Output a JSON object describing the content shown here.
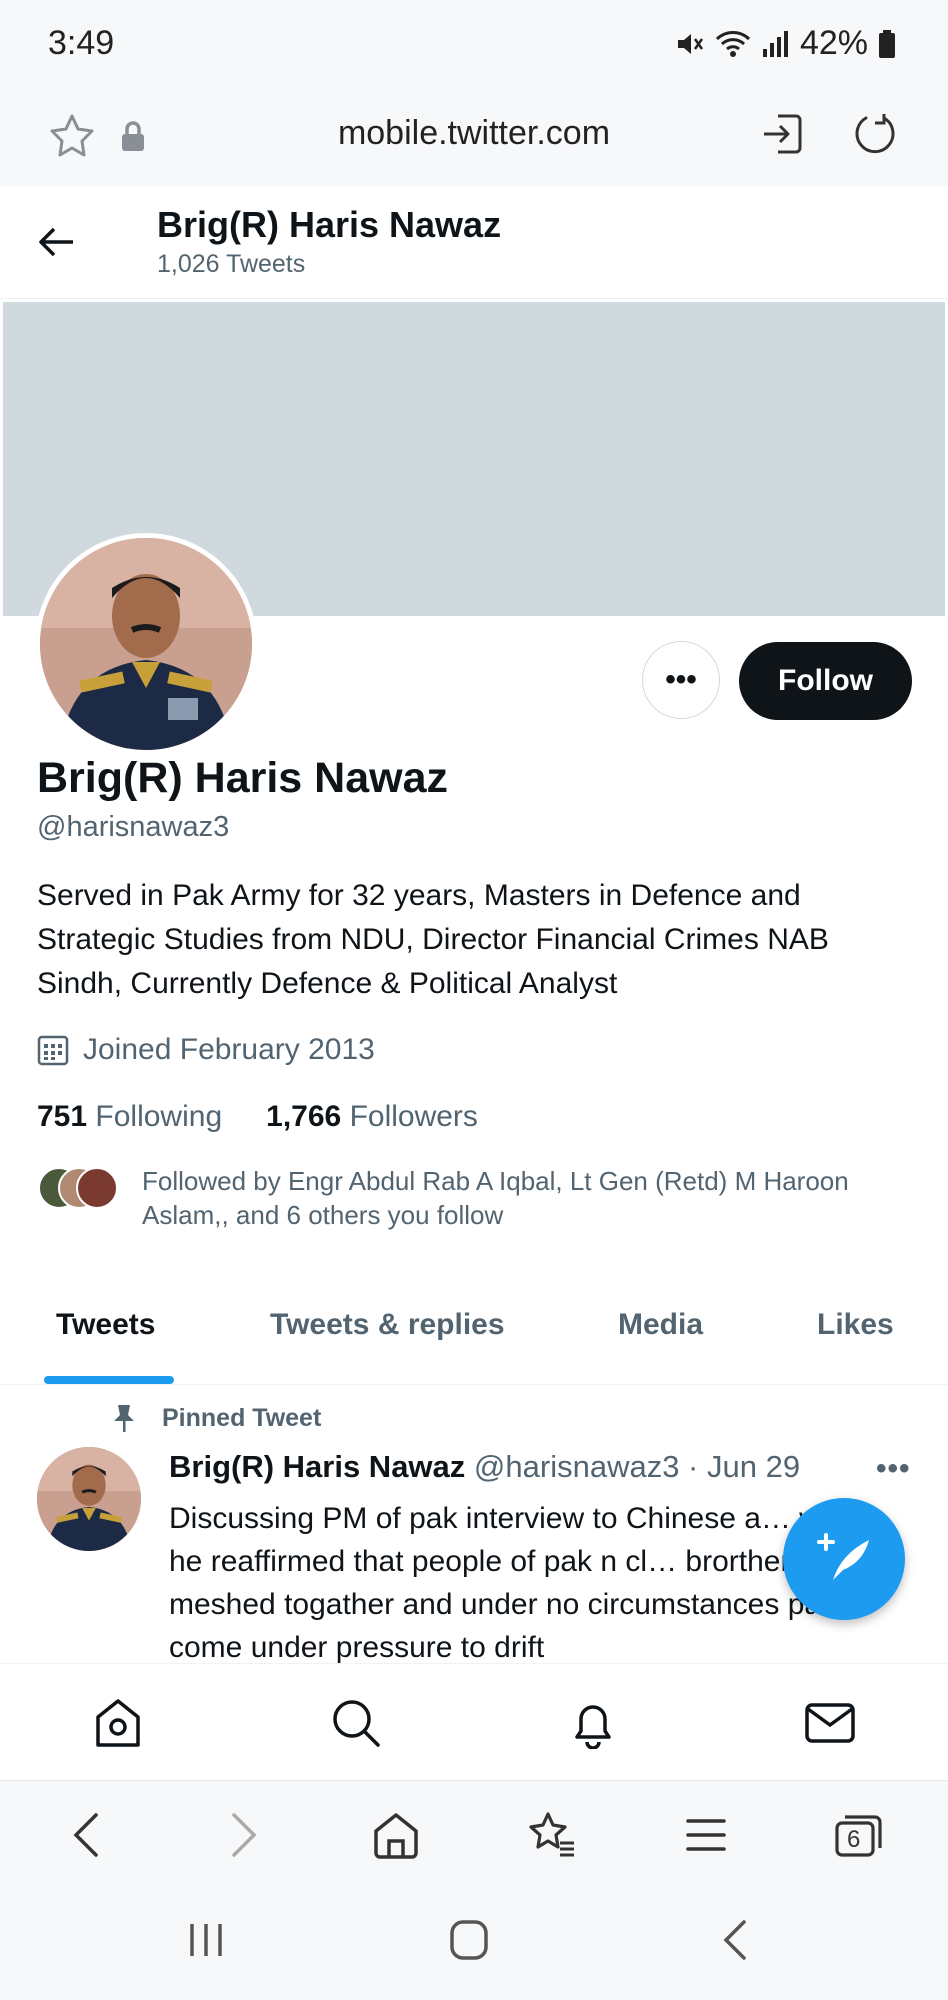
{
  "status_bar": {
    "time": "3:49",
    "battery": "42%"
  },
  "browser": {
    "url": "mobile.twitter.com",
    "tab_count": "6"
  },
  "header": {
    "name": "Brig(R) Haris Nawaz",
    "tweet_count": "1,026 Tweets"
  },
  "profile": {
    "name": "Brig(R) Haris Nawaz",
    "handle": "@harisnawaz3",
    "bio": "Served in Pak Army for 32 years, Masters in Defence and Strategic Studies from NDU, Director Financial Crimes NAB Sindh, Currently Defence & Political Analyst",
    "joined": "Joined February 2013",
    "following_count": "751",
    "following_label": "Following",
    "followers_count": "1,766",
    "followers_label": "Followers",
    "followed_by": "Followed by Engr Abdul Rab A Iqbal, Lt Gen (Retd) M Haroon Aslam,, and 6 others you follow",
    "follow_label": "Follow",
    "more_label": "•••"
  },
  "tabs": [
    {
      "label": "Tweets",
      "active": true
    },
    {
      "label": "Tweets & replies",
      "active": false
    },
    {
      "label": "Media",
      "active": false
    },
    {
      "label": "Likes",
      "active": false
    }
  ],
  "pinned_tweet": {
    "pinned_label": "Pinned Tweet",
    "author": "Brig(R) Haris Nawaz",
    "handle_date": "@harisnawaz3 · Jun 29",
    "more": "•••",
    "text": "Discussing PM of pak interview to Chinese a… where he reaffirmed that people of pak n cl… brorthers r meshed togather and under no circumstances pak wl come under pressure to drift"
  },
  "colors": {
    "accent": "#1d9bf0",
    "banner": "#cfd9de",
    "text": "#0f1419",
    "secondary": "#536471"
  },
  "icons": {
    "twitter_nav": [
      "home-icon",
      "search-icon",
      "bell-icon",
      "mail-icon"
    ],
    "browser_nav": [
      "back-icon",
      "forward-icon",
      "home-icon",
      "bookmarks-icon",
      "menu-icon",
      "tabs-icon"
    ],
    "system_nav": [
      "recents-icon",
      "home-icon",
      "back-icon"
    ]
  }
}
